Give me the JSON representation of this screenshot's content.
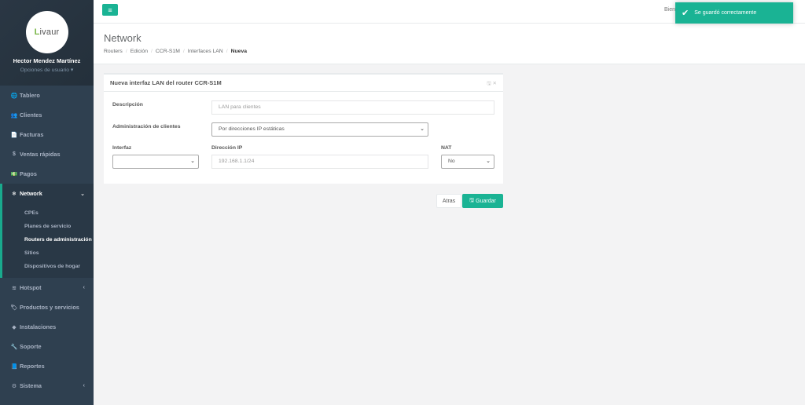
{
  "brand": {
    "logo_l": "L",
    "logo_rest": "ivaur",
    "accent": "#1ab394"
  },
  "user": {
    "name": "Hector Mendez Martínez",
    "options": "Opciones de usuario ▾"
  },
  "sidebar": {
    "items": [
      {
        "icon": "dashboard-icon",
        "glyph": "🌐",
        "label": "Tablero"
      },
      {
        "icon": "users-icon",
        "glyph": "👥",
        "label": "Clientes"
      },
      {
        "icon": "file-icon",
        "glyph": "📄",
        "label": "Facturas"
      },
      {
        "icon": "dollar-icon",
        "glyph": "$",
        "label": "Ventas rápidas"
      },
      {
        "icon": "money-icon",
        "glyph": "💵",
        "label": "Pagos"
      },
      {
        "icon": "network-icon",
        "glyph": "❄",
        "label": "Network",
        "chev": "⌄"
      },
      {
        "icon": "wifi-icon",
        "glyph": "≋",
        "label": "Hotspot",
        "chev": "‹"
      },
      {
        "icon": "tag-icon",
        "glyph": "🏷",
        "label": "Productos y servicios"
      },
      {
        "icon": "install-icon",
        "glyph": "◆",
        "label": "Instalaciones"
      },
      {
        "icon": "wrench-icon",
        "glyph": "🔧",
        "label": "Soporte"
      },
      {
        "icon": "book-icon",
        "glyph": "📘",
        "label": "Reportes"
      },
      {
        "icon": "cogs-icon",
        "glyph": "⚙",
        "label": "Sistema",
        "chev": "‹"
      }
    ],
    "network_sub": [
      "CPEs",
      "Planes de servicio",
      "Routers de administración",
      "Sitios",
      "Dispositivos de hogar"
    ]
  },
  "topbar": {
    "menu_glyph": "≡",
    "welcome": "Bien"
  },
  "page": {
    "title": "Network",
    "crumbs": [
      "Routers",
      "Edición",
      "CCR-S1M",
      "Interfaces LAN",
      "Nueva"
    ]
  },
  "form": {
    "title": "Nueva interfaz LAN del router CCR-S1M",
    "tools": "🖫 ✕",
    "descripcion_label": "Descripción",
    "descripcion_placeholder": "LAN para clientes",
    "admin_label": "Administración de clientes",
    "admin_value": "Por direcciones IP estáticas",
    "interfaz_label": "Interfaz",
    "interfaz_value": "",
    "ip_label": "Dirección IP",
    "ip_placeholder": "192.168.1.1/24",
    "nat_label": "NAT",
    "nat_value": "No",
    "back": "Atras",
    "save": "Guardar",
    "save_glyph": "🖫"
  },
  "toast": {
    "message": "Se guardó correctamente",
    "glyph": "✔"
  }
}
